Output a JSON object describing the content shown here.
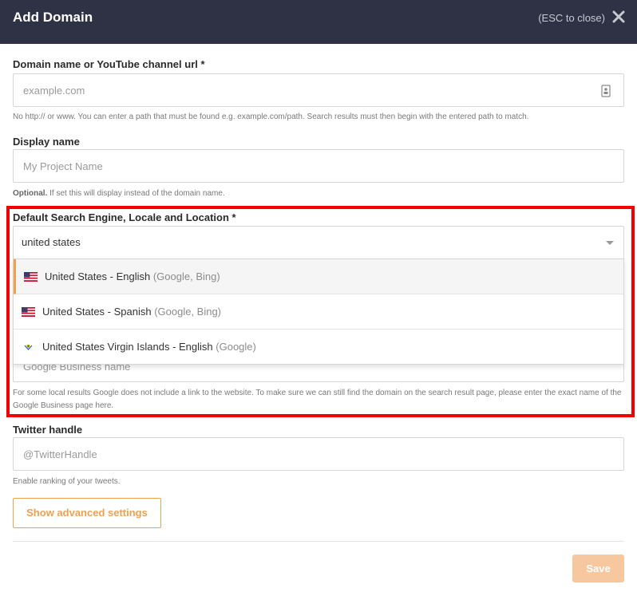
{
  "header": {
    "title": "Add Domain",
    "esc_hint": "(ESC to close)"
  },
  "domain": {
    "label": "Domain name or YouTube channel url *",
    "placeholder": "example.com",
    "help": "No http:// or www. You can enter a path that must be found e.g. example.com/path. Search results must then begin with the entered path to match."
  },
  "display_name": {
    "label": "Display name",
    "placeholder": "My Project Name",
    "help_bold": "Optional.",
    "help": " If set this will display instead of the domain name."
  },
  "engine": {
    "label": "Default Search Engine, Locale and Location *",
    "value": "united states",
    "options": [
      {
        "label": "United States - English",
        "engines": " (Google, Bing)",
        "flag": "us-flag-icon"
      },
      {
        "label": "United States - Spanish",
        "engines": " (Google, Bing)",
        "flag": "us-flag-icon"
      },
      {
        "label": "United States Virgin Islands - English",
        "engines": " (Google)",
        "flag": "vi-flag-icon"
      }
    ]
  },
  "gbp": {
    "placeholder": "Google Business name",
    "help": "For some local results Google does not include a link to the website. To make sure we can still find the domain on the search result page, please enter the exact name of the Google Business page here."
  },
  "twitter": {
    "label": "Twitter handle",
    "placeholder": "@TwitterHandle",
    "help": "Enable ranking of your tweets."
  },
  "buttons": {
    "advanced": "Show advanced settings",
    "save": "Save"
  },
  "colors": {
    "header_bg": "#2f3245",
    "accent": "#f0a150",
    "highlight": "#f20000"
  }
}
